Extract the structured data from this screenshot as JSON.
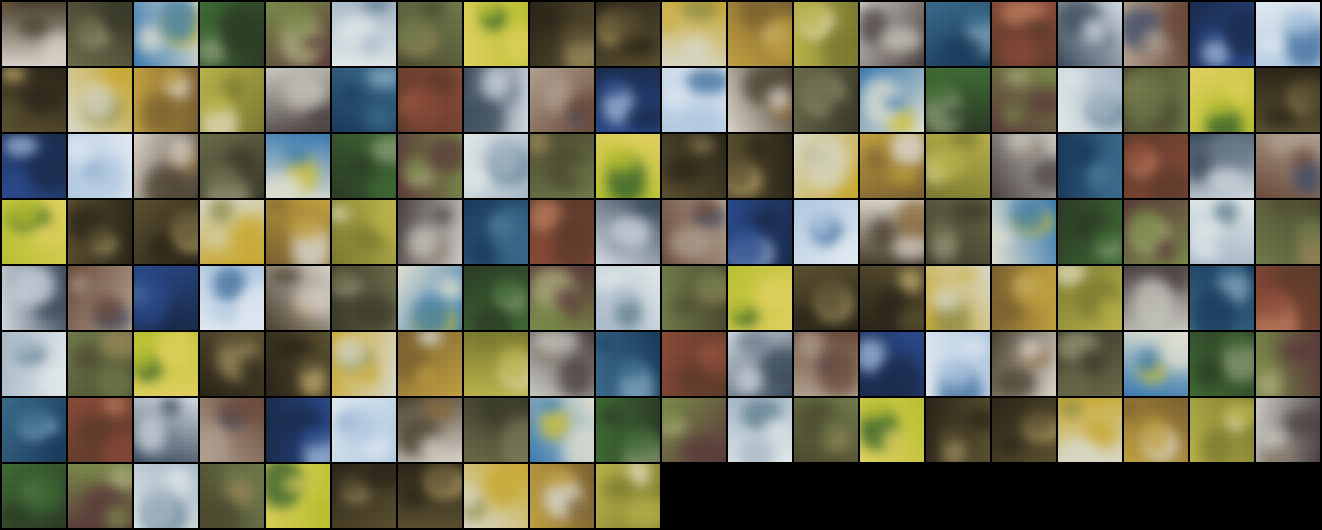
{
  "image": {
    "description_tag": "generated-image-sample-grid",
    "rows": 8,
    "cols": 20,
    "filled_tiles": 150,
    "background_color": "#000000",
    "tile_palettes": [
      [
        "#d9d2c8",
        "#8a6a3a",
        "#4a4030"
      ],
      [
        "#3f6b34",
        "#8fa07a",
        "#2b3b25"
      ],
      [
        "#6f7a4a",
        "#9a8a5a",
        "#4c4a30"
      ],
      [
        "#5a5030",
        "#c8b070",
        "#2a2418"
      ],
      [
        "#b9b24a",
        "#e8e0c0",
        "#7a7a30"
      ],
      [
        "#8a4a38",
        "#c08060",
        "#5a3a2a"
      ],
      [
        "#2a4a8a",
        "#a8c0e0",
        "#1a2a4a"
      ],
      [
        "#6a6a4a",
        "#9a9a7a",
        "#3a3a2a"
      ],
      [
        "#7a8a4a",
        "#b0b080",
        "#5a3a3a"
      ],
      [
        "#b8c030",
        "#2a5a2a",
        "#e0d060"
      ],
      [
        "#d8d8c8",
        "#8a8a4a",
        "#c8a830"
      ],
      [
        "#c8c8c0",
        "#8a7a6a",
        "#4a4040"
      ],
      [
        "#d0d8e0",
        "#6a7a8a",
        "#3a4a5a"
      ],
      [
        "#b0c8e0",
        "#3a6a9a",
        "#e0e8f0"
      ],
      [
        "#3a7ab0",
        "#d0c030",
        "#e0e0d0"
      ],
      [
        "#a8b8c8",
        "#5a7a8a",
        "#e0e8e8"
      ],
      [
        "#5a5030",
        "#a09060",
        "#2a2418"
      ],
      [
        "#c0a040",
        "#e0e0e0",
        "#7a6030"
      ],
      [
        "#3a6a8a",
        "#8ab0c8",
        "#1a3a5a"
      ],
      [
        "#6a4a3a",
        "#3a4a6a",
        "#b0a090"
      ]
    ]
  }
}
